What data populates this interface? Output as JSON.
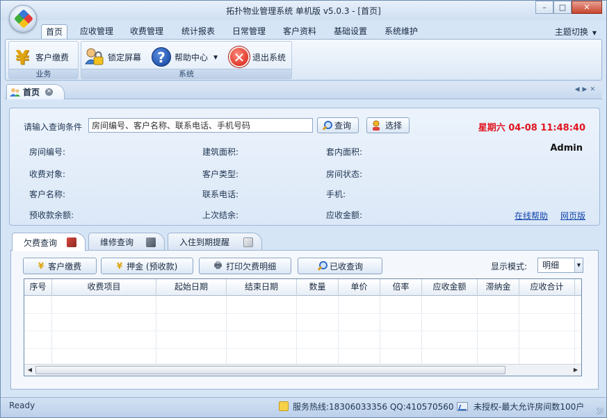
{
  "window": {
    "title": "拓扑物业管理系统 单机版 v5.0.3 - [首页]",
    "controls": {
      "minimize": "–",
      "maximize": "□",
      "close": "✕"
    }
  },
  "menu": {
    "items": [
      "首页",
      "应收管理",
      "收费管理",
      "统计报表",
      "日常管理",
      "客户资料",
      "基础设置",
      "系统维护"
    ],
    "theme_switch": "主题切换"
  },
  "ribbon": {
    "group_business": {
      "label": "业务",
      "pay": "客户缴费"
    },
    "group_system": {
      "label": "系统",
      "lock": "锁定屏幕",
      "help": "帮助中心",
      "exit": "退出系统"
    }
  },
  "doc_tab": {
    "label": "首页"
  },
  "query": {
    "label": "请输入查询条件",
    "placeholder": "房间编号、客户名称、联系电话、手机号码",
    "search_button": "查询",
    "select_button": "选择",
    "datetime": "星期六 04-08 11:48:40",
    "user": "Admin"
  },
  "fields": {
    "room_no": "房间编号:",
    "build_area": "建筑面积:",
    "inner_area": "套内面积:",
    "charge_target": "收费对象:",
    "customer_type": "客户类型:",
    "room_status": "房间状态:",
    "customer_name": "客户名称:",
    "phone": "联系电话:",
    "mobile": "手机:",
    "prepaid_balance": "预收款余额:",
    "last_balance": "上次结余:",
    "receivable": "应收金额:"
  },
  "links": {
    "online_help": "在线帮助",
    "web_version": "网页版"
  },
  "bottom_tabs": [
    "欠费查询",
    "维修查询",
    "入住到期提醒"
  ],
  "actions": {
    "pay": "客户缴费",
    "deposit": "押金 (预收款)",
    "print": "打印欠费明细",
    "collected": "已收查询",
    "mode_label": "显示模式:",
    "mode_value": "明细"
  },
  "grid": {
    "columns": [
      "序号",
      "收费项目",
      "起始日期",
      "结束日期",
      "数量",
      "单价",
      "倍率",
      "应收金额",
      "滞纳金",
      "应收合计"
    ]
  },
  "status": {
    "ready": "Ready",
    "hotline": "服务热线:18306033356 QQ:410570560",
    "license": "未授权-最大允许房间数100户"
  },
  "colors": {
    "accent": "#2d6bc6",
    "alert": "#e0141e",
    "link": "#1144aa"
  }
}
